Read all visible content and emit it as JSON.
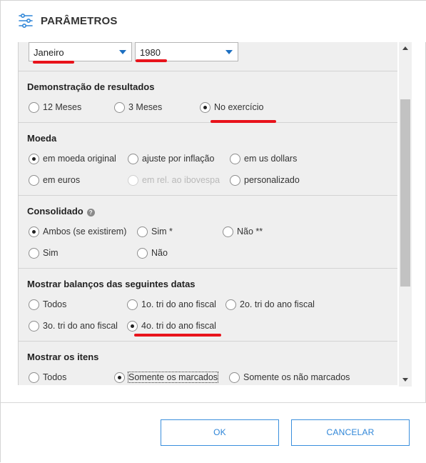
{
  "header": {
    "title": "PARÂMETROS",
    "icon": "sliders-icon"
  },
  "period": {
    "month_value": "Janeiro",
    "year_value": "1980"
  },
  "results": {
    "title": "Demonstração de resultados",
    "options": [
      "12 Meses",
      "3 Meses",
      "No exercício"
    ],
    "selected": "No exercício"
  },
  "currency": {
    "title": "Moeda",
    "options": [
      "em moeda original",
      "ajuste por inflação",
      "em us dollars",
      "em euros",
      "em rel. ao ibovespa",
      "personalizado"
    ],
    "disabled": [
      "em rel. ao ibovespa"
    ],
    "selected": "em moeda original"
  },
  "consolidated": {
    "title": "Consolidado",
    "help_icon": "?",
    "options": [
      "Ambos (se existirem)",
      "Sim *",
      "Não **",
      "Sim",
      "Não"
    ],
    "selected": "Ambos (se existirem)"
  },
  "balance_dates": {
    "title": "Mostrar balanços das seguintes datas",
    "options": [
      "Todos",
      "1o. tri do ano fiscal",
      "2o. tri do ano fiscal",
      "3o. tri do ano fiscal",
      "4o. tri do ano fiscal"
    ],
    "selected": "4o. tri do ano fiscal"
  },
  "items": {
    "title": "Mostrar os itens",
    "options": [
      "Todos",
      "Somente os marcados",
      "Somente os não marcados"
    ],
    "selected": "Somente os marcados"
  },
  "footer": {
    "ok_label": "OK",
    "cancel_label": "CANCELAR"
  },
  "colors": {
    "accent": "#2f86d8",
    "annotation_red": "#e8131b",
    "panel_bg": "#efefef"
  }
}
